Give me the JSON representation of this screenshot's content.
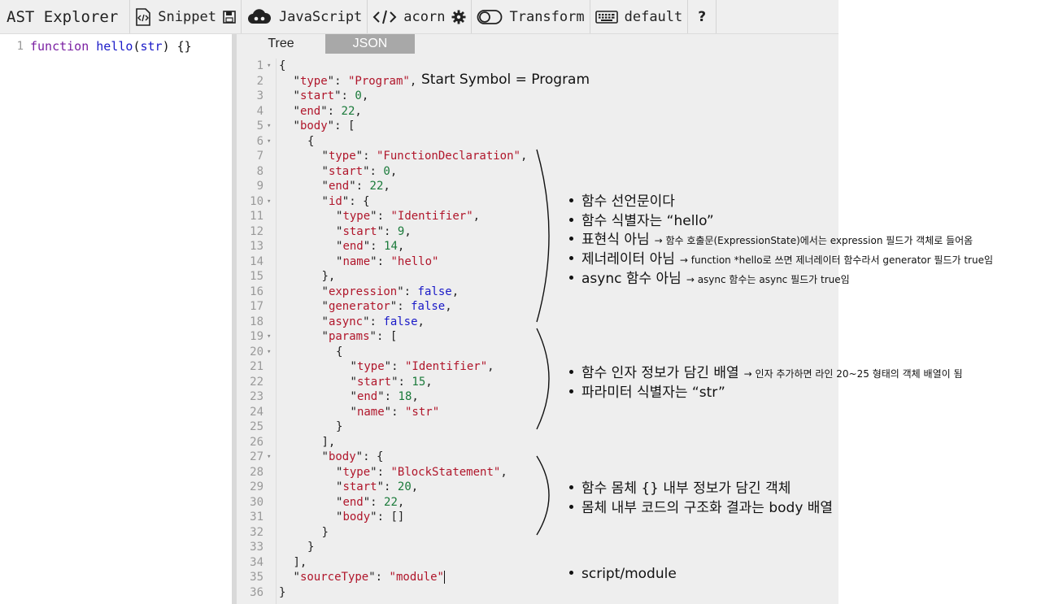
{
  "toolbar": {
    "title": "AST Explorer",
    "snippet_label": "Snippet",
    "language_label": "JavaScript",
    "parser_label": "acorn",
    "transform_label": "Transform",
    "keymap_label": "default",
    "help_label": "?"
  },
  "editor": {
    "line_number": "1",
    "code": {
      "keyword": "function",
      "name": "hello",
      "open": "(",
      "param": "str",
      "close": ") {}"
    }
  },
  "tabs": {
    "tree": "Tree",
    "json": "JSON"
  },
  "json_lines": [
    {
      "n": "1",
      "fold": true,
      "indent": 0,
      "text": "{"
    },
    {
      "n": "2",
      "fold": false,
      "indent": 1,
      "key": "type",
      "str": "Program",
      "trail": ","
    },
    {
      "n": "3",
      "fold": false,
      "indent": 1,
      "key": "start",
      "num": "0",
      "trail": ","
    },
    {
      "n": "4",
      "fold": false,
      "indent": 1,
      "key": "end",
      "num": "22",
      "trail": ","
    },
    {
      "n": "5",
      "fold": true,
      "indent": 1,
      "key": "body",
      "raw": "[",
      "trail": ""
    },
    {
      "n": "6",
      "fold": true,
      "indent": 2,
      "text": "{"
    },
    {
      "n": "7",
      "fold": false,
      "indent": 3,
      "key": "type",
      "str": "FunctionDeclaration",
      "trail": ","
    },
    {
      "n": "8",
      "fold": false,
      "indent": 3,
      "key": "start",
      "num": "0",
      "trail": ","
    },
    {
      "n": "9",
      "fold": false,
      "indent": 3,
      "key": "end",
      "num": "22",
      "trail": ","
    },
    {
      "n": "10",
      "fold": true,
      "indent": 3,
      "key": "id",
      "raw": "{",
      "trail": ""
    },
    {
      "n": "11",
      "fold": false,
      "indent": 4,
      "key": "type",
      "str": "Identifier",
      "trail": ","
    },
    {
      "n": "12",
      "fold": false,
      "indent": 4,
      "key": "start",
      "num": "9",
      "trail": ","
    },
    {
      "n": "13",
      "fold": false,
      "indent": 4,
      "key": "end",
      "num": "14",
      "trail": ","
    },
    {
      "n": "14",
      "fold": false,
      "indent": 4,
      "key": "name",
      "str": "hello",
      "trail": ""
    },
    {
      "n": "15",
      "fold": false,
      "indent": 3,
      "text": "},"
    },
    {
      "n": "16",
      "fold": false,
      "indent": 3,
      "key": "expression",
      "bool": "false",
      "trail": ","
    },
    {
      "n": "17",
      "fold": false,
      "indent": 3,
      "key": "generator",
      "bool": "false",
      "trail": ","
    },
    {
      "n": "18",
      "fold": false,
      "indent": 3,
      "key": "async",
      "bool": "false",
      "trail": ","
    },
    {
      "n": "19",
      "fold": true,
      "indent": 3,
      "key": "params",
      "raw": "[",
      "trail": ""
    },
    {
      "n": "20",
      "fold": true,
      "indent": 4,
      "text": "{"
    },
    {
      "n": "21",
      "fold": false,
      "indent": 5,
      "key": "type",
      "str": "Identifier",
      "trail": ","
    },
    {
      "n": "22",
      "fold": false,
      "indent": 5,
      "key": "start",
      "num": "15",
      "trail": ","
    },
    {
      "n": "23",
      "fold": false,
      "indent": 5,
      "key": "end",
      "num": "18",
      "trail": ","
    },
    {
      "n": "24",
      "fold": false,
      "indent": 5,
      "key": "name",
      "str": "str",
      "trail": ""
    },
    {
      "n": "25",
      "fold": false,
      "indent": 4,
      "text": "}"
    },
    {
      "n": "26",
      "fold": false,
      "indent": 3,
      "text": "],"
    },
    {
      "n": "27",
      "fold": true,
      "indent": 3,
      "key": "body",
      "raw": "{",
      "trail": ""
    },
    {
      "n": "28",
      "fold": false,
      "indent": 4,
      "key": "type",
      "str": "BlockStatement",
      "trail": ","
    },
    {
      "n": "29",
      "fold": false,
      "indent": 4,
      "key": "start",
      "num": "20",
      "trail": ","
    },
    {
      "n": "30",
      "fold": false,
      "indent": 4,
      "key": "end",
      "num": "22",
      "trail": ","
    },
    {
      "n": "31",
      "fold": false,
      "indent": 4,
      "key": "body",
      "raw": "[]",
      "trail": ""
    },
    {
      "n": "32",
      "fold": false,
      "indent": 3,
      "text": "}"
    },
    {
      "n": "33",
      "fold": false,
      "indent": 2,
      "text": "}"
    },
    {
      "n": "34",
      "fold": false,
      "indent": 1,
      "text": "],"
    },
    {
      "n": "35",
      "fold": false,
      "indent": 1,
      "key": "sourceType",
      "str": "module",
      "trail": "",
      "cursor": true
    },
    {
      "n": "36",
      "fold": false,
      "indent": 0,
      "text": "}"
    }
  ],
  "annotations": {
    "program": "Start Symbol = Program",
    "func_items": [
      {
        "main": "함수 선언문이다",
        "note": ""
      },
      {
        "main": "함수 식별자는  “hello”",
        "note": ""
      },
      {
        "main": "표현식 아님",
        "note": "→ 함수 호출문(ExpressionState)에서는 expression 필드가 객체로 들어옴"
      },
      {
        "main": "제너레이터 아님",
        "note": "→ function *hello로 쓰면 제너레이터 함수라서 generator 필드가 true임"
      },
      {
        "main": "async 함수 아님",
        "note": "→ async 함수는 async 필드가 true임"
      }
    ],
    "param_items": [
      {
        "main": "함수 인자 정보가 담긴 배열",
        "note": "→ 인자 추가하면 라인 20~25 형태의 객체 배열이 됨"
      },
      {
        "main": "파라미터 식별자는 “str”",
        "note": ""
      }
    ],
    "body_items": [
      {
        "main": "함수 몸체 {} 내부 정보가 담긴 객체",
        "note": ""
      },
      {
        "main": "몸체 내부 코드의 구조화 결과는 body 배열",
        "note": ""
      }
    ],
    "source_items": [
      {
        "main": "script/module",
        "note": ""
      }
    ]
  }
}
